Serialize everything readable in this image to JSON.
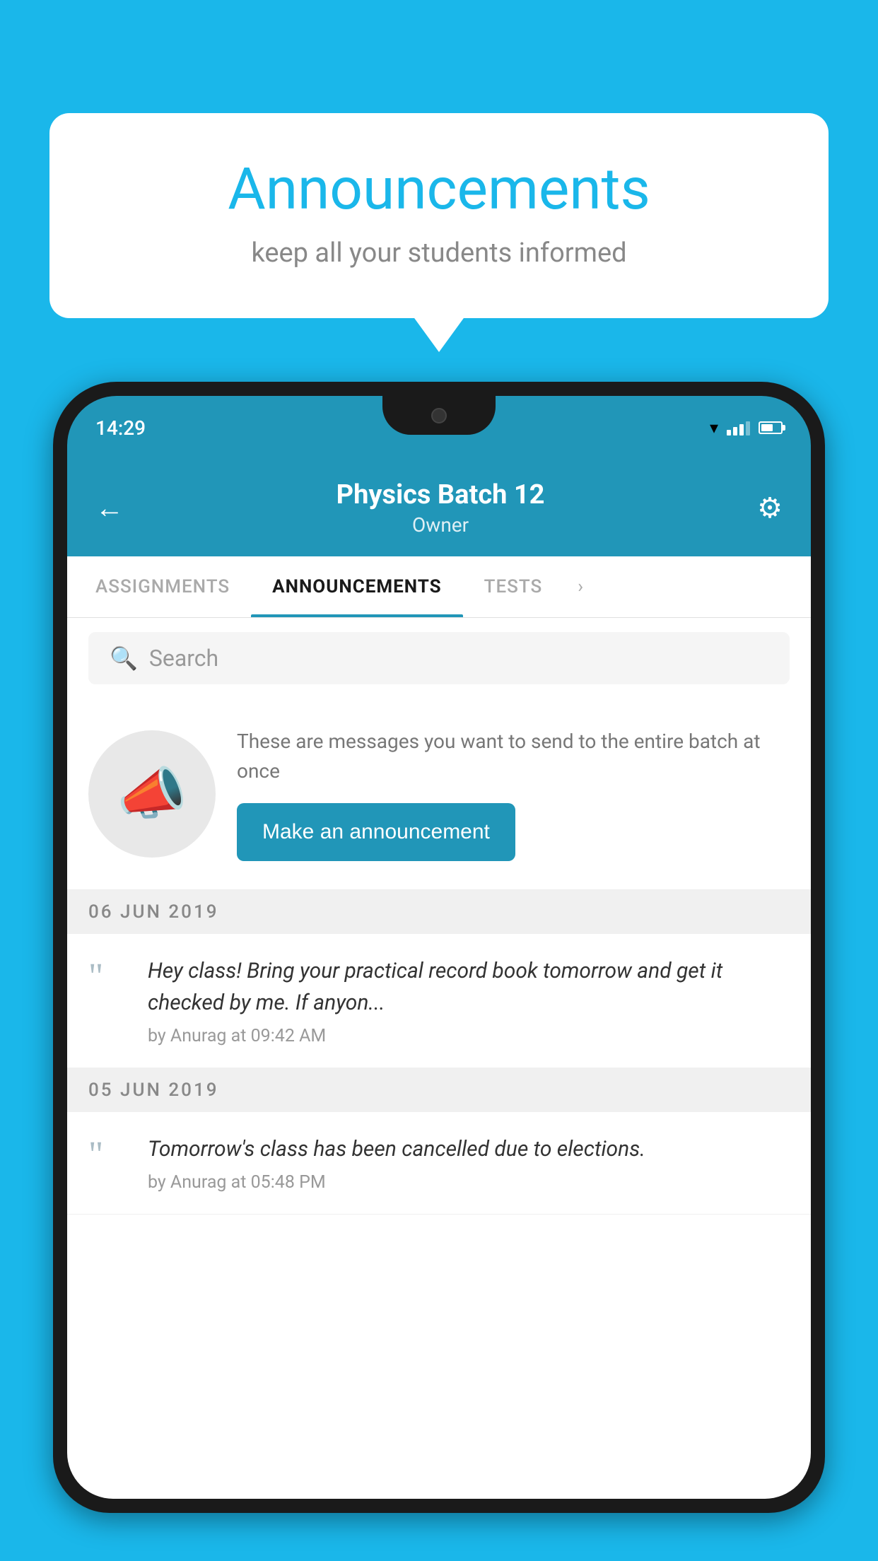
{
  "bubble": {
    "title": "Announcements",
    "subtitle": "keep all your students informed"
  },
  "phone": {
    "status_bar": {
      "time": "14:29"
    },
    "header": {
      "title": "Physics Batch 12",
      "subtitle": "Owner",
      "back_label": "←",
      "gear_label": "⚙"
    },
    "tabs": [
      {
        "label": "ASSIGNMENTS",
        "active": false
      },
      {
        "label": "ANNOUNCEMENTS",
        "active": true
      },
      {
        "label": "TESTS",
        "active": false
      },
      {
        "label": "›",
        "active": false
      }
    ],
    "search": {
      "placeholder": "Search"
    },
    "announcement_prompt": {
      "description": "These are messages you want to send to the entire batch at once",
      "button_label": "Make an announcement"
    },
    "announcements": [
      {
        "date": "06  JUN  2019",
        "text": "Hey class! Bring your practical record book tomorrow and get it checked by me. If anyon...",
        "meta": "by Anurag at 09:42 AM"
      },
      {
        "date": "05  JUN  2019",
        "text": "Tomorrow's class has been cancelled due to elections.",
        "meta": "by Anurag at 05:48 PM"
      }
    ]
  },
  "colors": {
    "sky_blue": "#1ab7ea",
    "app_blue": "#2196b8",
    "dark": "#1a1a1a"
  }
}
